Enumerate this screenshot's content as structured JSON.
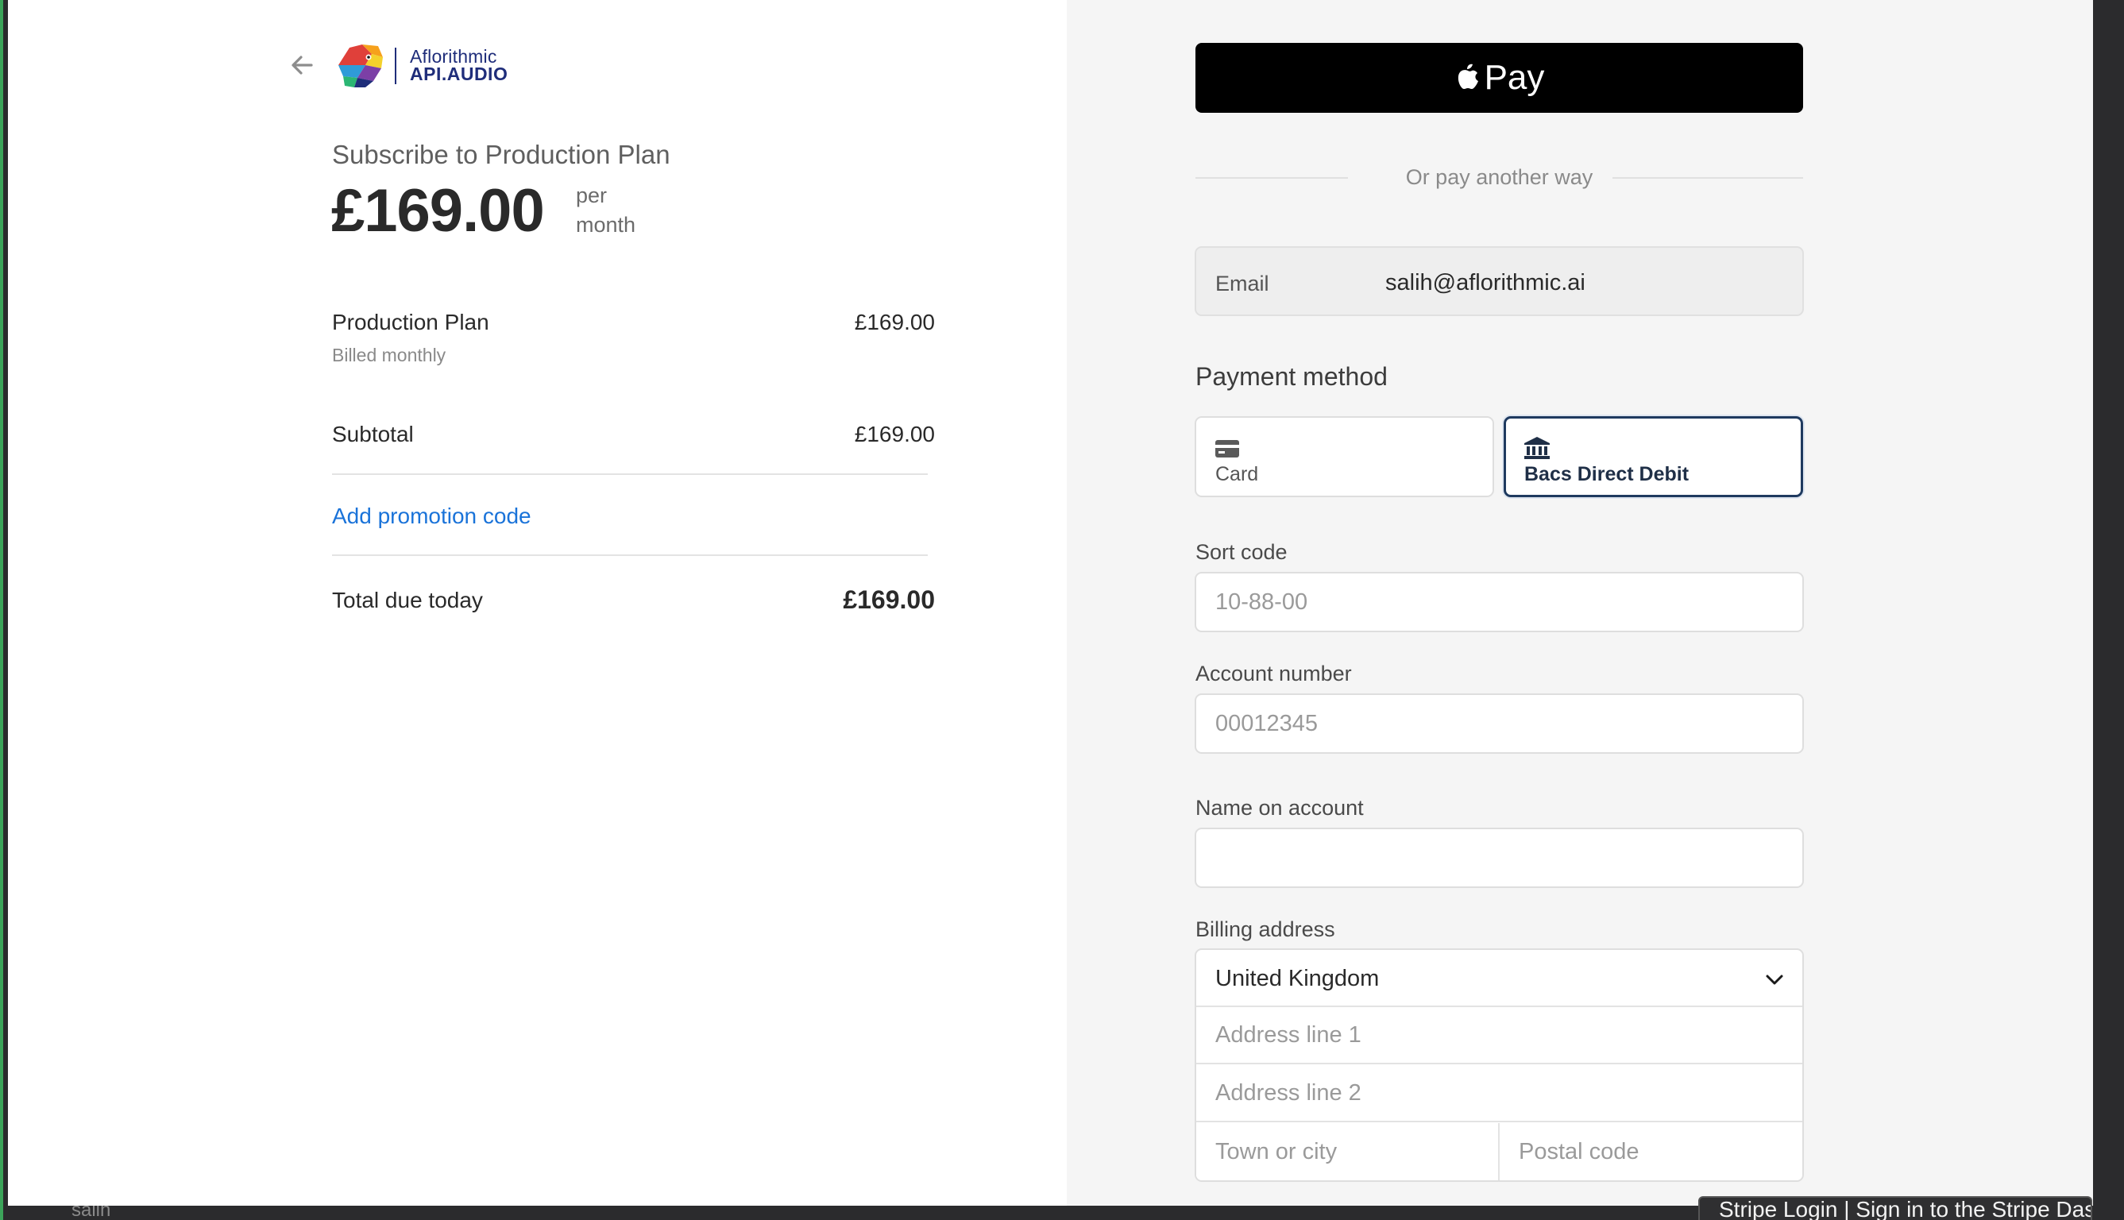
{
  "summary": {
    "logo": {
      "line1": "Aflorithmic",
      "line2": "API.AUDIO"
    },
    "subscribe_title": "Subscribe to Production Plan",
    "price": "£169.00",
    "per": "per",
    "month": "month",
    "line_item": {
      "name": "Production Plan",
      "price": "£169.00",
      "billing": "Billed monthly"
    },
    "subtotal_label": "Subtotal",
    "subtotal_value": "£169.00",
    "promo_label": "Add promotion code",
    "total_label": "Total due today",
    "total_value": "£169.00"
  },
  "payment": {
    "apple_pay_label": "Pay",
    "or_text": "Or pay another way",
    "email_label": "Email",
    "email_value": "salih@aflorithmic.ai",
    "method_heading": "Payment method",
    "methods": [
      {
        "label": "Card",
        "icon": "card-icon",
        "selected": false
      },
      {
        "label": "Bacs Direct Debit",
        "icon": "bank-icon",
        "selected": true
      }
    ],
    "sort_code": {
      "label": "Sort code",
      "placeholder": "10-88-00"
    },
    "account_number": {
      "label": "Account number",
      "placeholder": "00012345"
    },
    "name_on_account": {
      "label": "Name on account",
      "placeholder": ""
    },
    "billing": {
      "label": "Billing address",
      "country": "United Kingdom",
      "line1_placeholder": "Address line 1",
      "line2_placeholder": "Address line 2",
      "town_placeholder": "Town or city",
      "postal_placeholder": "Postal code"
    }
  },
  "os": {
    "taskbar_user": "salih",
    "tooltip": "Stripe Login | Sign in to the Stripe Dashboard"
  },
  "colors": {
    "accent_link": "#1a73d9",
    "brand_navy": "#1f2d7a",
    "selected_border": "#1f3a5f"
  }
}
